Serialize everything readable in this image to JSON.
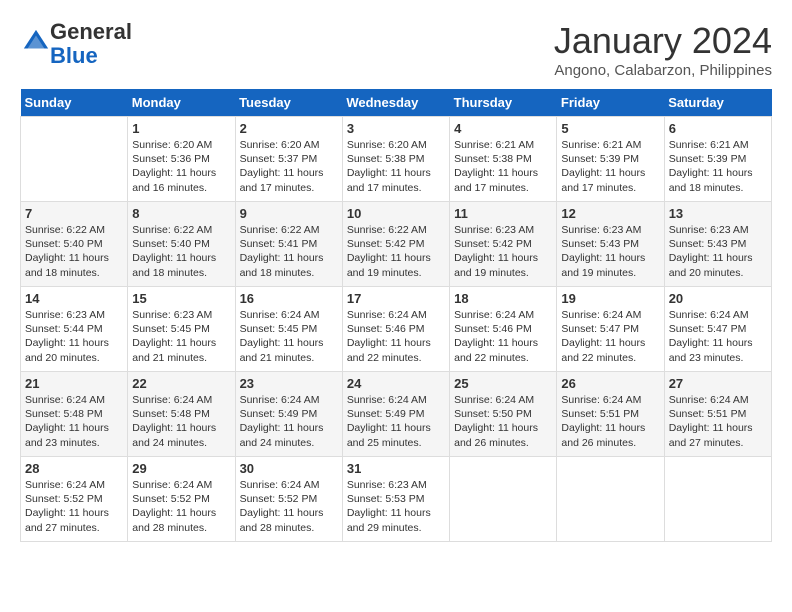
{
  "header": {
    "logo_line1": "General",
    "logo_line2": "Blue",
    "month": "January 2024",
    "location": "Angono, Calabarzon, Philippines"
  },
  "days_of_week": [
    "Sunday",
    "Monday",
    "Tuesday",
    "Wednesday",
    "Thursday",
    "Friday",
    "Saturday"
  ],
  "weeks": [
    [
      {
        "day": "",
        "info": ""
      },
      {
        "day": "1",
        "info": "Sunrise: 6:20 AM\nSunset: 5:36 PM\nDaylight: 11 hours\nand 16 minutes."
      },
      {
        "day": "2",
        "info": "Sunrise: 6:20 AM\nSunset: 5:37 PM\nDaylight: 11 hours\nand 17 minutes."
      },
      {
        "day": "3",
        "info": "Sunrise: 6:20 AM\nSunset: 5:38 PM\nDaylight: 11 hours\nand 17 minutes."
      },
      {
        "day": "4",
        "info": "Sunrise: 6:21 AM\nSunset: 5:38 PM\nDaylight: 11 hours\nand 17 minutes."
      },
      {
        "day": "5",
        "info": "Sunrise: 6:21 AM\nSunset: 5:39 PM\nDaylight: 11 hours\nand 17 minutes."
      },
      {
        "day": "6",
        "info": "Sunrise: 6:21 AM\nSunset: 5:39 PM\nDaylight: 11 hours\nand 18 minutes."
      }
    ],
    [
      {
        "day": "7",
        "info": "Sunrise: 6:22 AM\nSunset: 5:40 PM\nDaylight: 11 hours\nand 18 minutes."
      },
      {
        "day": "8",
        "info": "Sunrise: 6:22 AM\nSunset: 5:40 PM\nDaylight: 11 hours\nand 18 minutes."
      },
      {
        "day": "9",
        "info": "Sunrise: 6:22 AM\nSunset: 5:41 PM\nDaylight: 11 hours\nand 18 minutes."
      },
      {
        "day": "10",
        "info": "Sunrise: 6:22 AM\nSunset: 5:42 PM\nDaylight: 11 hours\nand 19 minutes."
      },
      {
        "day": "11",
        "info": "Sunrise: 6:23 AM\nSunset: 5:42 PM\nDaylight: 11 hours\nand 19 minutes."
      },
      {
        "day": "12",
        "info": "Sunrise: 6:23 AM\nSunset: 5:43 PM\nDaylight: 11 hours\nand 19 minutes."
      },
      {
        "day": "13",
        "info": "Sunrise: 6:23 AM\nSunset: 5:43 PM\nDaylight: 11 hours\nand 20 minutes."
      }
    ],
    [
      {
        "day": "14",
        "info": "Sunrise: 6:23 AM\nSunset: 5:44 PM\nDaylight: 11 hours\nand 20 minutes."
      },
      {
        "day": "15",
        "info": "Sunrise: 6:23 AM\nSunset: 5:45 PM\nDaylight: 11 hours\nand 21 minutes."
      },
      {
        "day": "16",
        "info": "Sunrise: 6:24 AM\nSunset: 5:45 PM\nDaylight: 11 hours\nand 21 minutes."
      },
      {
        "day": "17",
        "info": "Sunrise: 6:24 AM\nSunset: 5:46 PM\nDaylight: 11 hours\nand 22 minutes."
      },
      {
        "day": "18",
        "info": "Sunrise: 6:24 AM\nSunset: 5:46 PM\nDaylight: 11 hours\nand 22 minutes."
      },
      {
        "day": "19",
        "info": "Sunrise: 6:24 AM\nSunset: 5:47 PM\nDaylight: 11 hours\nand 22 minutes."
      },
      {
        "day": "20",
        "info": "Sunrise: 6:24 AM\nSunset: 5:47 PM\nDaylight: 11 hours\nand 23 minutes."
      }
    ],
    [
      {
        "day": "21",
        "info": "Sunrise: 6:24 AM\nSunset: 5:48 PM\nDaylight: 11 hours\nand 23 minutes."
      },
      {
        "day": "22",
        "info": "Sunrise: 6:24 AM\nSunset: 5:48 PM\nDaylight: 11 hours\nand 24 minutes."
      },
      {
        "day": "23",
        "info": "Sunrise: 6:24 AM\nSunset: 5:49 PM\nDaylight: 11 hours\nand 24 minutes."
      },
      {
        "day": "24",
        "info": "Sunrise: 6:24 AM\nSunset: 5:49 PM\nDaylight: 11 hours\nand 25 minutes."
      },
      {
        "day": "25",
        "info": "Sunrise: 6:24 AM\nSunset: 5:50 PM\nDaylight: 11 hours\nand 26 minutes."
      },
      {
        "day": "26",
        "info": "Sunrise: 6:24 AM\nSunset: 5:51 PM\nDaylight: 11 hours\nand 26 minutes."
      },
      {
        "day": "27",
        "info": "Sunrise: 6:24 AM\nSunset: 5:51 PM\nDaylight: 11 hours\nand 27 minutes."
      }
    ],
    [
      {
        "day": "28",
        "info": "Sunrise: 6:24 AM\nSunset: 5:52 PM\nDaylight: 11 hours\nand 27 minutes."
      },
      {
        "day": "29",
        "info": "Sunrise: 6:24 AM\nSunset: 5:52 PM\nDaylight: 11 hours\nand 28 minutes."
      },
      {
        "day": "30",
        "info": "Sunrise: 6:24 AM\nSunset: 5:52 PM\nDaylight: 11 hours\nand 28 minutes."
      },
      {
        "day": "31",
        "info": "Sunrise: 6:23 AM\nSunset: 5:53 PM\nDaylight: 11 hours\nand 29 minutes."
      },
      {
        "day": "",
        "info": ""
      },
      {
        "day": "",
        "info": ""
      },
      {
        "day": "",
        "info": ""
      }
    ]
  ]
}
